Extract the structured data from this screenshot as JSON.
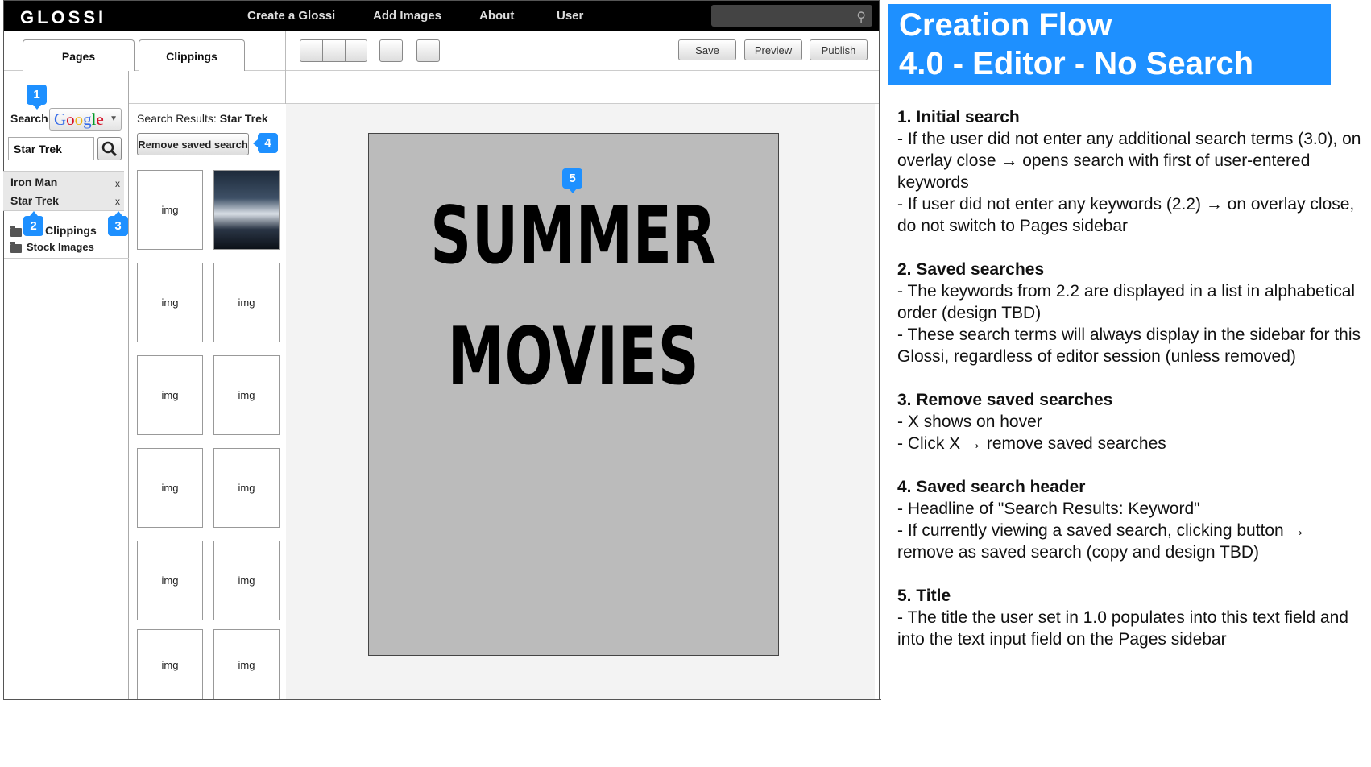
{
  "app": {
    "logo": "GLOSSI",
    "nav": [
      "Create a Glossi",
      "Add Images",
      "About",
      "User"
    ]
  },
  "tabs": {
    "pages": "Pages",
    "clippings": "Clippings"
  },
  "actions": {
    "save": "Save",
    "preview": "Preview",
    "publish": "Publish"
  },
  "sidebar": {
    "search_label": "Search",
    "engine": "Google",
    "query": "Star Trek",
    "saved_searches": [
      {
        "label": "Iron Man",
        "remove": "x"
      },
      {
        "label": "Star Trek",
        "remove": "x"
      }
    ],
    "folders": [
      "Clippings",
      "Stock Images"
    ]
  },
  "results": {
    "header_prefix": "Search Results:",
    "header_keyword": "Star Trek",
    "remove_button": "Remove saved search",
    "thumbs": [
      "img",
      "poster",
      "img",
      "img",
      "img",
      "img",
      "img",
      "img",
      "img",
      "img",
      "img",
      "img"
    ]
  },
  "canvas": {
    "title_line1": "SUMMER",
    "title_line2": "MOVIES"
  },
  "callouts": [
    "1",
    "2",
    "3",
    "4",
    "5"
  ],
  "flow": {
    "line1": "Creation Flow",
    "line2": "4.0 - Editor - No Search"
  },
  "notes": [
    {
      "title": "1. Initial search",
      "lines": [
        "- If the user did not enter any additional search terms (3.0), on overlay close → opens search with first of user-entered keywords",
        "- If user did not enter any keywords (2.2) → on overlay close, do not switch to Pages sidebar"
      ]
    },
    {
      "title": "2. Saved searches",
      "lines": [
        "- The keywords from 2.2 are displayed in a list in alphabetical order (design TBD)",
        "- These search terms will always display in the sidebar for this Glossi, regardless of editor session (unless removed)"
      ]
    },
    {
      "title": "3. Remove saved searches",
      "lines": [
        "- X shows on hover",
        "- Click X → remove saved searches"
      ]
    },
    {
      "title": "4. Saved search header",
      "lines": [
        "- Headline of \"Search Results: Keyword\"",
        "- If currently viewing a saved search, clicking button → remove as saved search (copy and design TBD)"
      ]
    },
    {
      "title": "5. Title",
      "lines": [
        "- The title the user set in 1.0 populates into this text field and into the text input field on the Pages sidebar"
      ]
    }
  ],
  "colors": {
    "accent": "#1e90ff",
    "topbar": "#000000",
    "page": "#bbbbbb"
  }
}
